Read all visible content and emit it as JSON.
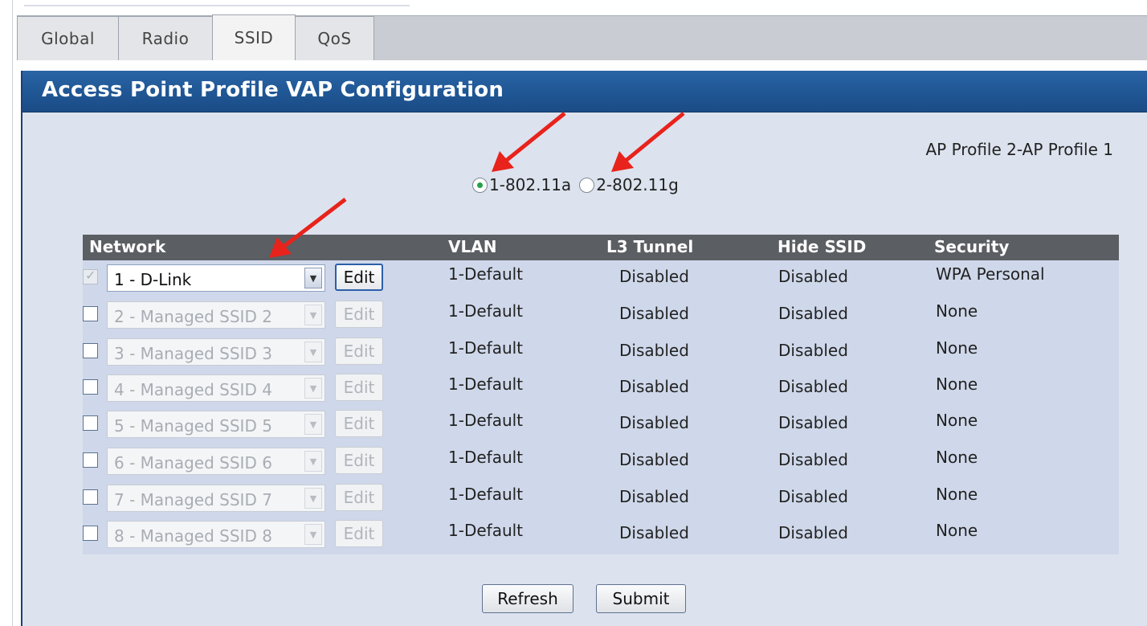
{
  "tabs": [
    {
      "label": "Global",
      "active": false
    },
    {
      "label": "Radio",
      "active": false
    },
    {
      "label": "SSID",
      "active": true
    },
    {
      "label": "QoS",
      "active": false
    }
  ],
  "panel": {
    "title": "Access Point Profile VAP Configuration",
    "profile_label": "AP Profile 2-AP Profile 1"
  },
  "radios": [
    {
      "label": "1-802.11a",
      "checked": true
    },
    {
      "label": "2-802.11g",
      "checked": false
    }
  ],
  "table": {
    "headers": {
      "network": "Network",
      "vlan": "VLAN",
      "l3_tunnel": "L3 Tunnel",
      "hide_ssid": "Hide SSID",
      "security": "Security"
    },
    "edit_label": "Edit",
    "rows": [
      {
        "checked": true,
        "enabled": true,
        "network": "1 - D-Link",
        "vlan": "1-Default",
        "l3_tunnel": "Disabled",
        "hide_ssid": "Disabled",
        "security": "WPA Personal"
      },
      {
        "checked": false,
        "enabled": false,
        "network": "2 - Managed SSID 2",
        "vlan": "1-Default",
        "l3_tunnel": "Disabled",
        "hide_ssid": "Disabled",
        "security": "None"
      },
      {
        "checked": false,
        "enabled": false,
        "network": "3 - Managed SSID 3",
        "vlan": "1-Default",
        "l3_tunnel": "Disabled",
        "hide_ssid": "Disabled",
        "security": "None"
      },
      {
        "checked": false,
        "enabled": false,
        "network": "4 - Managed SSID 4",
        "vlan": "1-Default",
        "l3_tunnel": "Disabled",
        "hide_ssid": "Disabled",
        "security": "None"
      },
      {
        "checked": false,
        "enabled": false,
        "network": "5 - Managed SSID 5",
        "vlan": "1-Default",
        "l3_tunnel": "Disabled",
        "hide_ssid": "Disabled",
        "security": "None"
      },
      {
        "checked": false,
        "enabled": false,
        "network": "6 - Managed SSID 6",
        "vlan": "1-Default",
        "l3_tunnel": "Disabled",
        "hide_ssid": "Disabled",
        "security": "None"
      },
      {
        "checked": false,
        "enabled": false,
        "network": "7 - Managed SSID 7",
        "vlan": "1-Default",
        "l3_tunnel": "Disabled",
        "hide_ssid": "Disabled",
        "security": "None"
      },
      {
        "checked": false,
        "enabled": false,
        "network": "8 - Managed SSID 8",
        "vlan": "1-Default",
        "l3_tunnel": "Disabled",
        "hide_ssid": "Disabled",
        "security": "None"
      }
    ]
  },
  "buttons": {
    "refresh": "Refresh",
    "submit": "Submit"
  },
  "colors": {
    "header_bar": "#1f5694",
    "panel_bg": "#dce3ee",
    "table_header": "#5b5e63",
    "annotation_arrow": "#e8231c"
  },
  "icons": {
    "dropdown": "chevron-down-icon",
    "annotation": "red-arrow-icon"
  }
}
